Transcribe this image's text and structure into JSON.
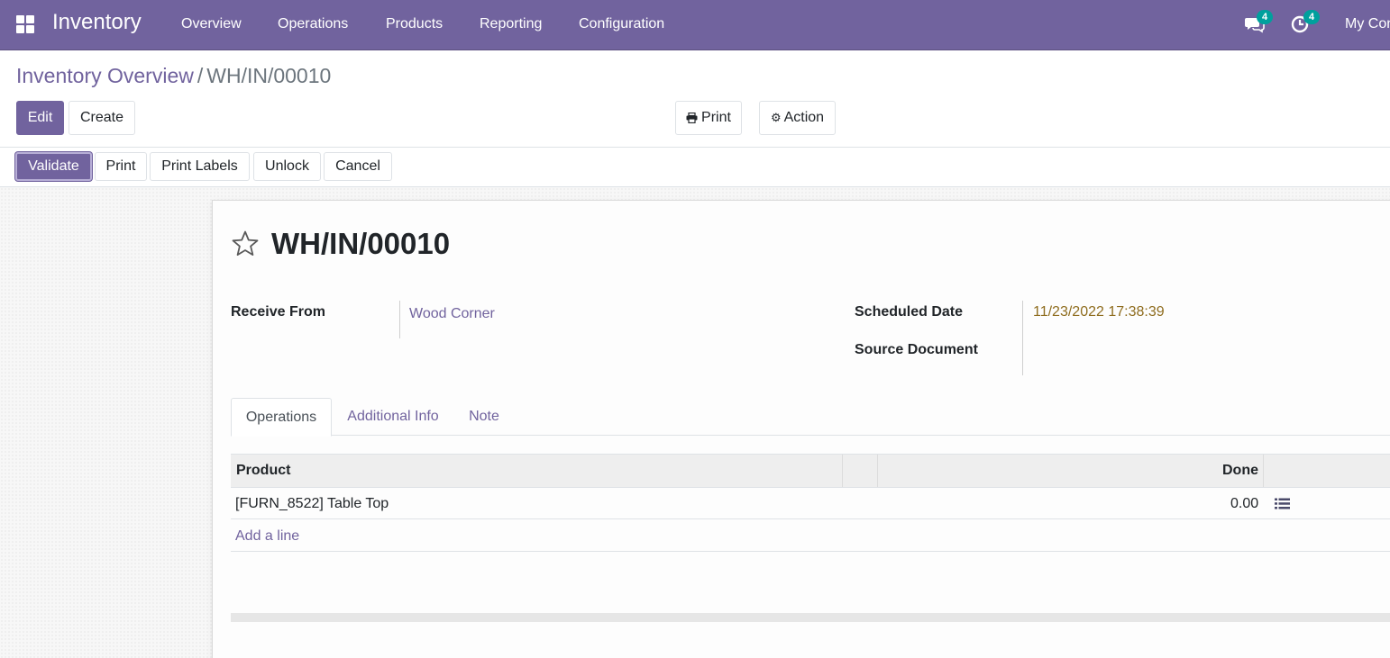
{
  "navbar": {
    "app_name": "Inventory",
    "menu": [
      "Overview",
      "Operations",
      "Products",
      "Reporting",
      "Configuration"
    ],
    "messages_count": "4",
    "activities_count": "4",
    "company": "My Con"
  },
  "breadcrumb": {
    "parent": "Inventory Overview",
    "separator": "/",
    "current": "WH/IN/00010"
  },
  "control": {
    "edit_label": "Edit",
    "create_label": "Create",
    "print_label": "Print",
    "action_label": "Action"
  },
  "statusbar": {
    "validate": "Validate",
    "print": "Print",
    "print_labels": "Print Labels",
    "unlock": "Unlock",
    "cancel": "Cancel"
  },
  "record": {
    "title": "WH/IN/00010",
    "receive_from_label": "Receive From",
    "receive_from_value": "Wood Corner",
    "scheduled_date_label": "Scheduled Date",
    "scheduled_date_value": "11/23/2022 17:38:39",
    "source_document_label": "Source Document",
    "source_document_value": ""
  },
  "tabs": [
    "Operations",
    "Additional Info",
    "Note"
  ],
  "table": {
    "columns": [
      "Product",
      "",
      "Done"
    ],
    "rows": [
      {
        "product": "[FURN_8522] Table Top",
        "done": "0.00"
      }
    ],
    "add_line": "Add a line"
  },
  "colors": {
    "brand": "#71639e",
    "badge": "#00a09d",
    "date_text": "#8f6d1f"
  },
  "icons": {
    "apps": "apps-grid-icon",
    "messages": "chat-icon",
    "activities": "clock-icon",
    "print": "printer-icon",
    "action": "gear-icon",
    "favorite": "star-outline-icon",
    "detail": "list-icon"
  }
}
